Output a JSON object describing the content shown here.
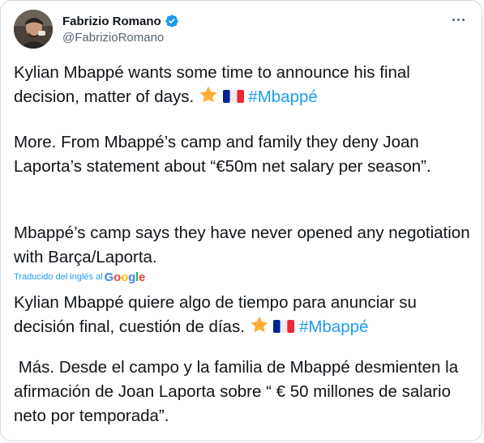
{
  "author": {
    "display_name": "Fabrizio Romano",
    "handle": "@FabrizioRomano"
  },
  "icons": {
    "avatar": "profile-photo",
    "verified": "verified-badge-icon",
    "more": "more-options-icon",
    "star": "star-emoji",
    "flag": "france-flag-emoji"
  },
  "colors": {
    "hashtag": "#1d9bf0",
    "secondary_text": "#536471",
    "border": "#cfd9de"
  },
  "tweet": {
    "line1a": "Kylian Mbappé wants some time to announce his final",
    "line1b": "decision, matter of days.",
    "hashtag1": "#Mbappé",
    "para2": "More. From Mbappé’s camp and family they deny Joan Laporta’s statement about “€50m net salary per season”.",
    "para3": "Mbappé’s camp says they have never opened any negotiation with Barça/Laporta."
  },
  "translation": {
    "label": "Traducido del inglés al",
    "provider": "Google",
    "line1a": "Kylian Mbappé quiere algo de tiempo para anunciar su",
    "line1b": "decisión final, cuestión de días.",
    "hashtag": "#Mbappé",
    "para2": " Más. Desde el campo y la familia de Mbappé desmienten la afirmación de Joan Laporta sobre “ € 50 millones de salario neto por temporada”."
  }
}
